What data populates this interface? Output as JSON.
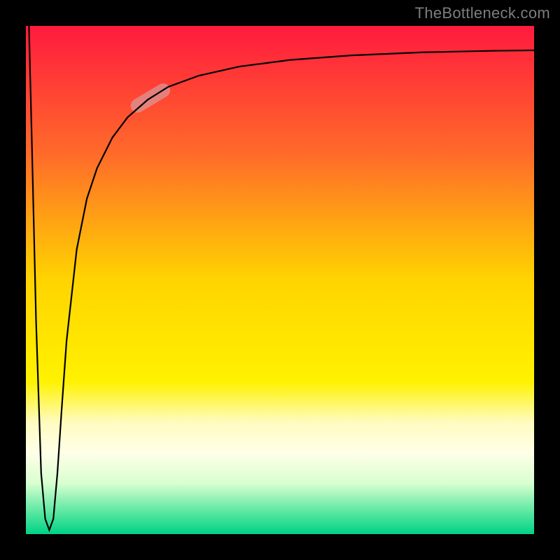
{
  "attribution": "TheBottleneck.com",
  "chart_data": {
    "type": "line",
    "title": "",
    "xlabel": "",
    "ylabel": "",
    "xlim": [
      0,
      100
    ],
    "ylim": [
      0,
      100
    ],
    "grid": false,
    "legend": false,
    "background_gradient_stops": [
      {
        "offset": 0.0,
        "color": "#ff1a3e"
      },
      {
        "offset": 0.25,
        "color": "#ff6a2a"
      },
      {
        "offset": 0.5,
        "color": "#ffd400"
      },
      {
        "offset": 0.7,
        "color": "#fff200"
      },
      {
        "offset": 0.78,
        "color": "#fffbc0"
      },
      {
        "offset": 0.84,
        "color": "#ffffe8"
      },
      {
        "offset": 0.9,
        "color": "#d8ffd0"
      },
      {
        "offset": 0.96,
        "color": "#52e59e"
      },
      {
        "offset": 1.0,
        "color": "#00d285"
      }
    ],
    "series": [
      {
        "name": "curve",
        "color": "#000000",
        "width": 2.2,
        "x": [
          0.6,
          1.2,
          2.0,
          3.0,
          3.8,
          4.6,
          5.4,
          6.2,
          7.0,
          8.0,
          10.0,
          12.0,
          14.0,
          17.0,
          20.0,
          24.0,
          28.0,
          34.0,
          42.0,
          52.0,
          64.0,
          78.0,
          92.0,
          100.0
        ],
        "y": [
          100.0,
          76.0,
          42.0,
          12.0,
          3.0,
          0.8,
          3.0,
          12.0,
          24.0,
          38.0,
          56.0,
          66.0,
          72.0,
          78.0,
          82.0,
          85.5,
          88.0,
          90.2,
          92.0,
          93.3,
          94.2,
          94.8,
          95.1,
          95.2
        ]
      }
    ],
    "highlight_segment": {
      "color": "#d5a0a4",
      "opacity": 0.65,
      "width": 20,
      "x": [
        22.0,
        27.0
      ],
      "y": [
        84.3,
        87.3
      ]
    }
  }
}
